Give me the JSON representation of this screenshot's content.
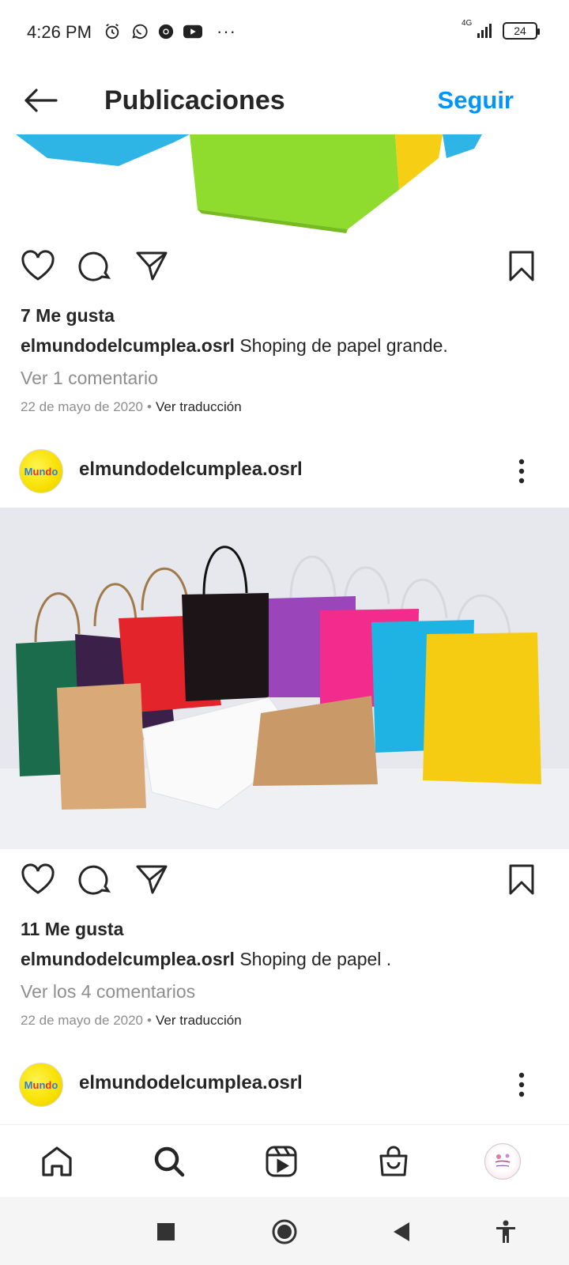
{
  "status_bar": {
    "time": "4:26 PM",
    "icons": [
      "alarm-icon",
      "whatsapp-icon",
      "chrome-icon",
      "youtube-icon"
    ],
    "more": "···",
    "network": "4G",
    "battery": "24"
  },
  "header": {
    "title": "Publicaciones",
    "follow_label": "Seguir"
  },
  "posts": [
    {
      "likes": "7 Me gusta",
      "username": "elmundodelcumplea.osrl",
      "caption": "Shoping de papel grande.",
      "comments": "Ver 1 comentario",
      "date": "22 de mayo de 2020",
      "translate": "Ver traducción"
    },
    {
      "username": "elmundodelcumplea.osrl",
      "likes": "11 Me gusta",
      "caption": "Shoping de papel .",
      "comments": "Ver los 4 comentarios",
      "date": "22 de mayo de 2020",
      "translate": "Ver traducción"
    },
    {
      "username": "elmundodelcumplea.osrl"
    }
  ],
  "bottom_nav": [
    "home-icon",
    "search-icon",
    "reels-icon",
    "shop-icon",
    "profile-avatar"
  ],
  "colors": {
    "accent": "#0095f6",
    "text": "#262626",
    "muted": "#8e8e8e"
  }
}
